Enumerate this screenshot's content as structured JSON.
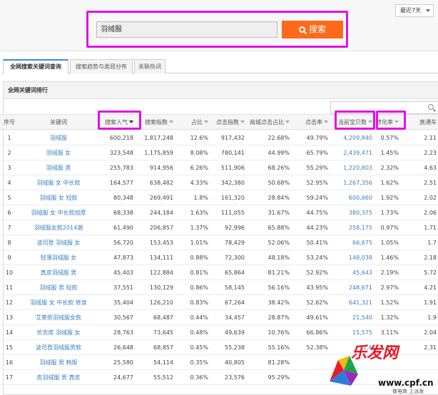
{
  "top": {
    "date_range": "最近7天",
    "search_value": "羽绒服",
    "search_button": "搜索"
  },
  "tabs": [
    "全网搜索关键词查询",
    "搜索趋势与类目分布",
    "关联热词"
  ],
  "panel": {
    "title": "全网关键词排行"
  },
  "table": {
    "headers": [
      "序号",
      "关键词",
      "搜索人气",
      "搜索指数",
      "占比",
      "点击指数",
      "商城点击占比",
      "点击率",
      "当前宝贝数",
      "转化率",
      "直通车"
    ],
    "rows": [
      [
        "1",
        "羽绒服",
        "600,218",
        "1,817,248",
        "12.6%",
        "917,432",
        "22.68%",
        "49.79%",
        "4,209,840",
        "0.57%",
        "2.11"
      ],
      [
        "2",
        "羽绒服 女",
        "323,548",
        "1,175,859",
        "8.08%",
        "780,141",
        "44.99%",
        "65.79%",
        "2,439,471",
        "1.45%",
        "2.23"
      ],
      [
        "3",
        "羽绒服 男",
        "255,783",
        "914,956",
        "6.26%",
        "511,906",
        "68.26%",
        "55.29%",
        "1,220,803",
        "2.32%",
        "4.63"
      ],
      [
        "4",
        "羽绒服 女 中长款",
        "164,577",
        "638,482",
        "4.33%",
        "342,380",
        "50.68%",
        "52.95%",
        "1,267,356",
        "1.62%",
        "2.51"
      ],
      [
        "5",
        "羽绒服 女 短款",
        "80,348",
        "269,491",
        "1.8%",
        "161,320",
        "28.84%",
        "59.24%",
        "600,660",
        "1.92%",
        "2.02"
      ],
      [
        "6",
        "羽绒服 女 中长款加厚",
        "68,338",
        "244,184",
        "1.63%",
        "111,055",
        "31.67%",
        "44.75%",
        "380,375",
        "1.73%",
        "2.06"
      ],
      [
        "7",
        "羽绒服女款2014潮",
        "61,490",
        "206,857",
        "1.37%",
        "92,996",
        "65.88%",
        "44.23%",
        "258,175",
        "0.97%",
        "1.71"
      ],
      [
        "8",
        "波司登 羽绒服 女",
        "56,720",
        "153,453",
        "1.01%",
        "78,429",
        "52.06%",
        "50.41%",
        "66,675",
        "1.05%",
        "1.7"
      ],
      [
        "9",
        "轻薄羽绒服 女",
        "47,873",
        "134,111",
        "0.88%",
        "72,300",
        "48.18%",
        "53.24%",
        "148,038",
        "1.46%",
        "2.18"
      ],
      [
        "10",
        "真皮羽绒服 男",
        "45,403",
        "122,884",
        "0.81%",
        "65,864",
        "81.21%",
        "52.92%",
        "45,643",
        "2.19%",
        "5.72"
      ],
      [
        "11",
        "羽绒服 男 短款",
        "37,551",
        "130,129",
        "0.86%",
        "58,145",
        "56.16%",
        "43.95%",
        "248,671",
        "2.97%",
        "4.21"
      ],
      [
        "12",
        "羽绒服 女 中长款 修身",
        "35,404",
        "126,210",
        "0.83%",
        "67,264",
        "38.42%",
        "52.62%",
        "641,321",
        "1.52%",
        "1.91"
      ],
      [
        "13",
        "艾莱依羽绒服女款",
        "30,567",
        "68,487",
        "0.44%",
        "34,457",
        "28.87%",
        "49.61%",
        "21,540",
        "1.32%",
        "1.9"
      ],
      [
        "14",
        "优衣库 羽绒服 女",
        "28,763",
        "73,645",
        "0.48%",
        "49,639",
        "10.76%",
        "66.86%",
        "15,575",
        "3.11%",
        "2.04"
      ],
      [
        "15",
        "波司登羽绒服男款",
        "26,648",
        "68,857",
        "0.45%",
        "55,238",
        "55.16%",
        "52.38%",
        "32,6",
        "1.32%",
        "2.31"
      ],
      [
        "16",
        "羽绒服 男 韩版",
        "25,580",
        "54,114",
        "0.35%",
        "40,805",
        "81.28%",
        "",
        "",
        "",
        ""
      ],
      [
        "17",
        "皮羽绒服 男 真皮",
        "24,677",
        "55,512",
        "0.36%",
        "23,576",
        "95.29%",
        "",
        "",
        "",
        ""
      ]
    ]
  },
  "watermark": {
    "brand": "乐发网",
    "url": "www.cpf.cn",
    "sub": "做电商 上派发"
  },
  "colors": {
    "accent_orange": "#ff6a1a",
    "highlight_magenta": "#e012e0",
    "link_blue": "#3a7fc1",
    "tab_blue": "#3a8cd8"
  }
}
